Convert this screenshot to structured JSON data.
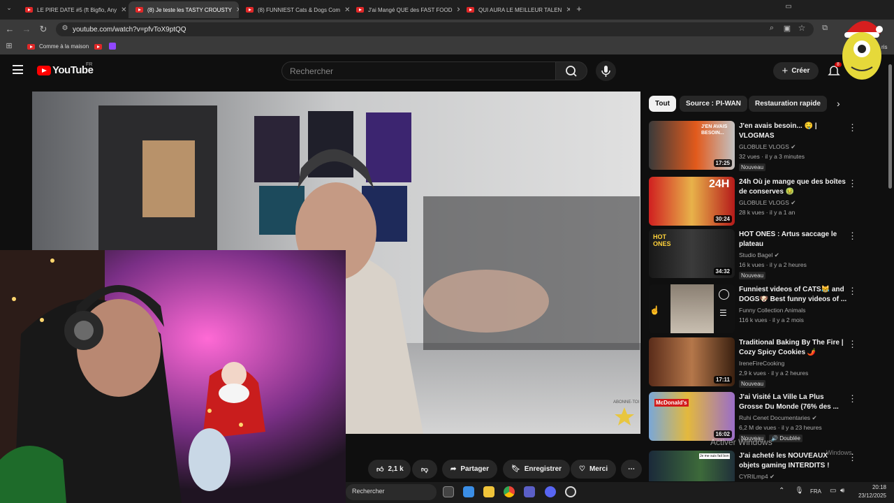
{
  "browser": {
    "tabs": [
      {
        "label": "LE PIRE DATE #5 (ft Bigflo, Any"
      },
      {
        "label": "(8) Je teste les TASTY CROUSTY"
      },
      {
        "label": "(8) FUNNIEST Cats & Dogs Com"
      },
      {
        "label": "J'ai Mangé QUE des FAST FOOD"
      },
      {
        "label": "QUI AURA LE MEILLEUR TALEN"
      }
    ],
    "active_tab_index": 1,
    "url": "youtube.com/watch?v=pfvToX9ptQQ",
    "bookmark_label": "Comme à la maison",
    "overflow_text": "ris"
  },
  "youtube": {
    "logo_text": "YouTube",
    "country": "FR",
    "search_placeholder": "Rechercher",
    "create_label": "Créer",
    "notif_count": "8"
  },
  "video": {
    "overlay_text": "ABONNE-TOI"
  },
  "chips": [
    "Tout",
    "Source : PI-WAN",
    "Restauration rapide"
  ],
  "recommendations": [
    {
      "title": "J'en avais besoin... 🤤 | VLOGMAS",
      "channel": "GLOBULE VLOGS",
      "verified": true,
      "meta": "32 vues · il y a 3 minutes",
      "badge": "Nouveau",
      "duration": "17:25",
      "thumb_text": "J'EN AVAIS BESOIN..."
    },
    {
      "title": "24h Où je mange que des boîtes de conserves 🤢",
      "channel": "GLOBULE VLOGS",
      "verified": true,
      "meta": "28 k vues · il y a 1 an",
      "badge": "",
      "duration": "30:24",
      "thumb_text": "24H"
    },
    {
      "title": "HOT ONES : Artus saccage le plateau",
      "channel": "Studio Bagel",
      "verified": true,
      "meta": "16 k vues · il y a 2 heures",
      "badge": "Nouveau",
      "duration": "34:32",
      "thumb_text": "HOT ONES"
    },
    {
      "title": "Funniest videos of CATS😹 and DOGS🐶 Best funny videos of ...",
      "channel": "Funny Collection Animals",
      "verified": false,
      "meta": "116 k vues · il y a 2 mois",
      "badge": "",
      "duration": "",
      "thumb_text": ""
    },
    {
      "title": "Traditional Baking By The Fire | Cozy Spicy Cookies 🌶️",
      "channel": "IreneFireCooking",
      "verified": false,
      "meta": "2,9 k vues · il y a 2 heures",
      "badge": "Nouveau",
      "duration": "17:11",
      "thumb_text": ""
    },
    {
      "title": "J'ai Visité La Ville La Plus Grosse Du Monde (76% des ...",
      "channel": "Ruhi Cenet Documentaries",
      "verified": true,
      "meta": "6,2 M de vues · il y a 23 heures",
      "badge": "Nouveau",
      "badge2": "Doublée",
      "duration": "16:02",
      "thumb_text": "McDonald's"
    },
    {
      "title": "J'ai acheté les NOUVEAUX objets gaming INTERDITS !",
      "channel": "CYRILmp4",
      "verified": true,
      "meta": "",
      "badge": "",
      "duration": "",
      "thumb_text": "Je me suis fait bon"
    }
  ],
  "actions": {
    "likes": "2,1 k",
    "share": "Partager",
    "save": "Enregistrer",
    "thanks": "Merci"
  },
  "taskbar": {
    "search": "Rechercher",
    "lang": "FRA",
    "time": "20:18",
    "date": "23/12/2025"
  },
  "watermark": {
    "line1": "Activer Windows",
    "line2": "Windows."
  }
}
